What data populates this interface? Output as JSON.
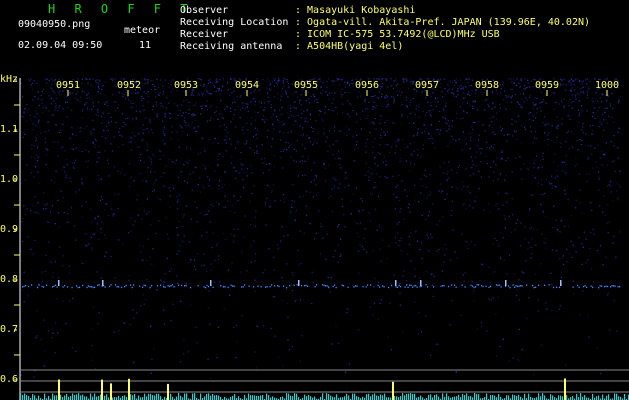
{
  "header": {
    "app_title": "H R O F F T",
    "file_name": "09040950.png",
    "meteor_label": "meteor",
    "date_time": "02.09.04 09:50",
    "meteor_count": "11",
    "fields": [
      {
        "label": "Observer",
        "value": ": Masayuki Kobayashi"
      },
      {
        "label": "Receiving Location",
        "value": ": Ogata-vill. Akita-Pref. JAPAN (139.96E, 40.02N)"
      },
      {
        "label": "Receiver",
        "value": ": ICOM IC-575 53.7492(@LCD)MHz USB"
      },
      {
        "label": "Receiving antenna",
        "value": ": A504HB(yagi 4el)"
      }
    ]
  },
  "axis": {
    "y_unit": "kHz",
    "y_ticks": [
      "1.1",
      "1.0",
      "0.9",
      "0.8",
      "0.7",
      "0.6"
    ],
    "time_ticks": [
      "0951",
      "0952",
      "0953",
      "0954",
      "0955",
      "0956",
      "0957",
      "0958",
      "0959",
      "1000"
    ]
  },
  "colors": {
    "background": "#000000",
    "title_green": "#1ad31a",
    "label_yellow": "#ffff66",
    "noise_blue": "#1a2a9a",
    "echo_line": "#3b8cff",
    "baseline_cyan": "#30d0d0"
  }
}
